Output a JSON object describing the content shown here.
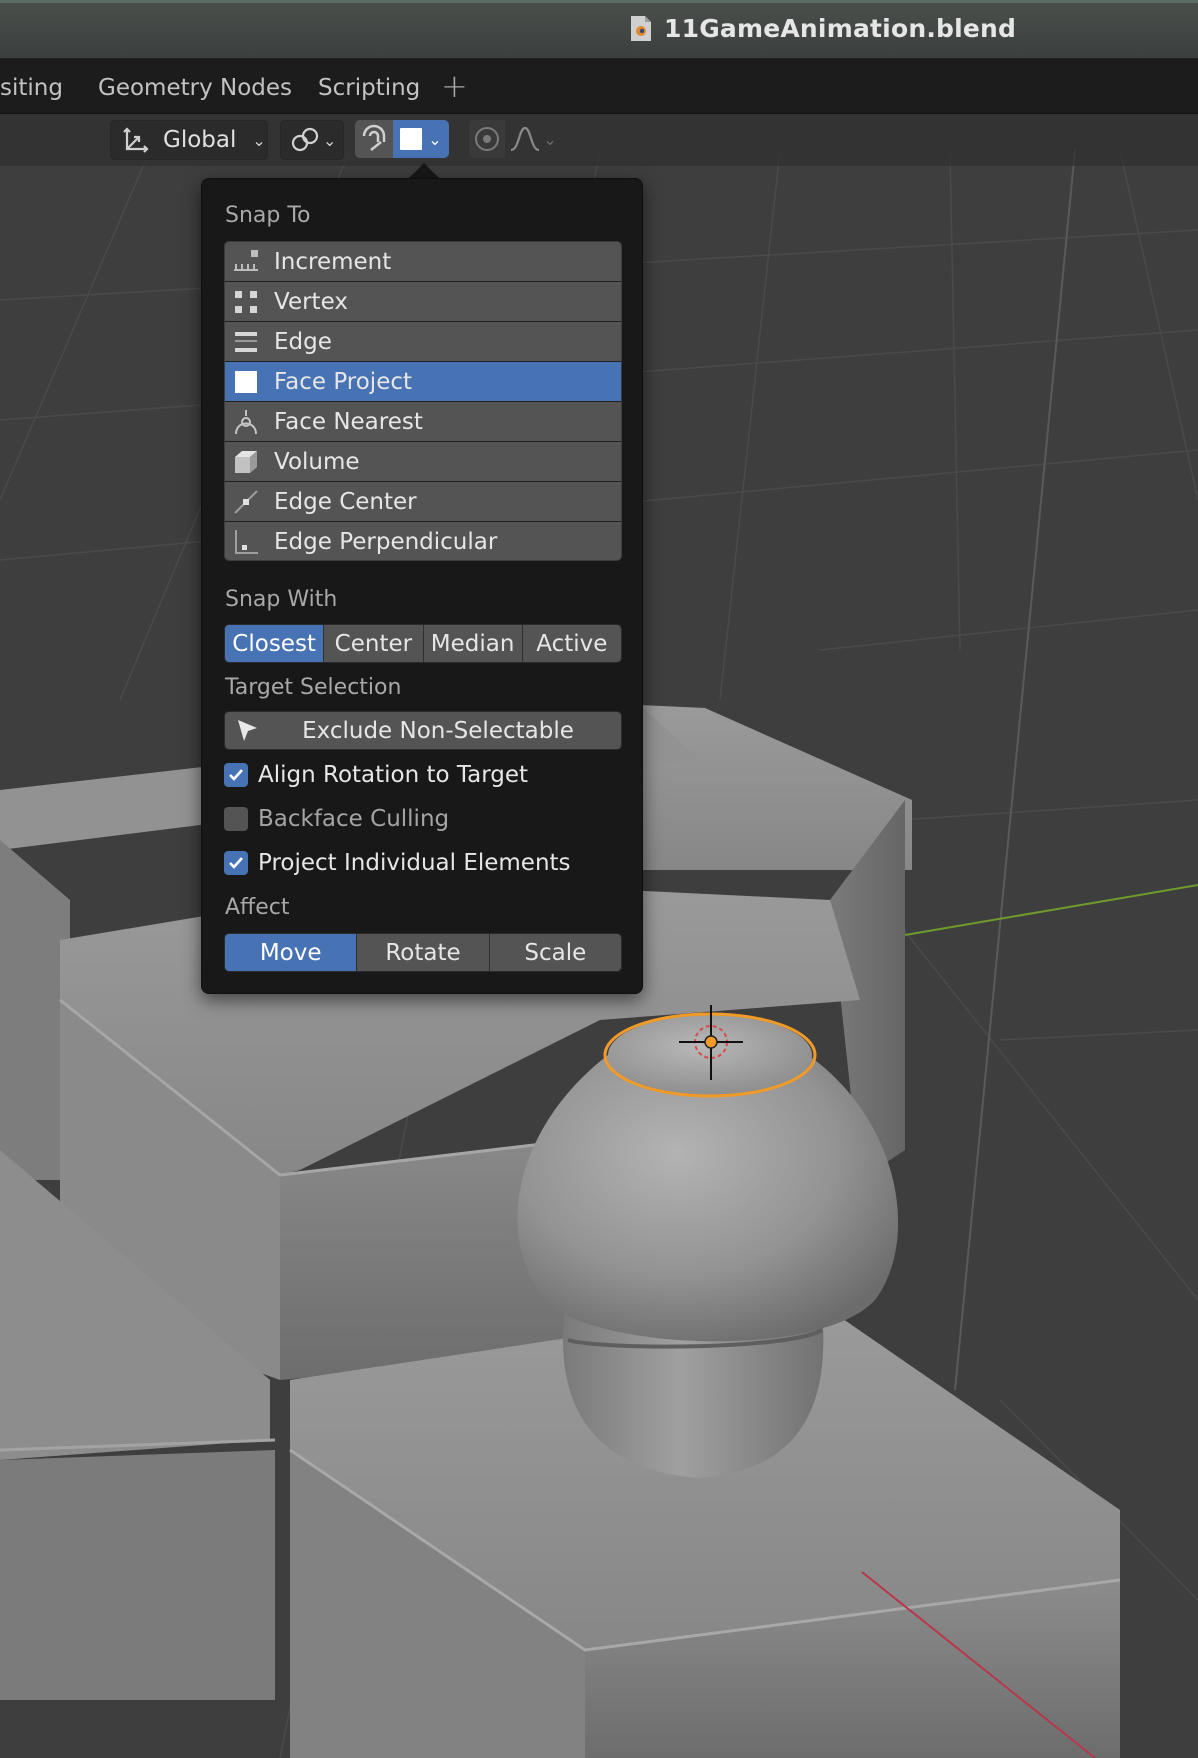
{
  "window": {
    "title": "11GameAnimation.blend",
    "file_icon": "blend-file-icon"
  },
  "workspace_tabs": [
    {
      "label": "siting"
    },
    {
      "label": "Geometry Nodes"
    },
    {
      "label": "Scripting"
    }
  ],
  "workspace_add": "+",
  "header": {
    "orientation": {
      "label": "Global",
      "icon": "transform-orientation-icon"
    },
    "pivot_icon": "pivot-point-icon",
    "snap": {
      "enabled": false,
      "current_type_icon": "face-project-icon"
    },
    "proportional": {
      "enabled": false,
      "falloff_icon": "smooth-falloff-icon"
    }
  },
  "snap_popup": {
    "snap_to_label": "Snap To",
    "snap_to_items": [
      {
        "label": "Increment",
        "icon": "increment-icon",
        "selected": false
      },
      {
        "label": "Vertex",
        "icon": "vertex-icon",
        "selected": false
      },
      {
        "label": "Edge",
        "icon": "edge-icon",
        "selected": false
      },
      {
        "label": "Face Project",
        "icon": "face-project-icon",
        "selected": true
      },
      {
        "label": "Face Nearest",
        "icon": "face-nearest-icon",
        "selected": false
      },
      {
        "label": "Volume",
        "icon": "volume-icon",
        "selected": false
      },
      {
        "label": "Edge Center",
        "icon": "edge-center-icon",
        "selected": false
      },
      {
        "label": "Edge Perpendicular",
        "icon": "edge-perpendicular-icon",
        "selected": false
      }
    ],
    "snap_with_label": "Snap With",
    "snap_with_options": [
      {
        "label": "Closest",
        "active": true
      },
      {
        "label": "Center",
        "active": false
      },
      {
        "label": "Median",
        "active": false
      },
      {
        "label": "Active",
        "active": false
      }
    ],
    "target_selection_label": "Target Selection",
    "exclude_button": "Exclude Non-Selectable",
    "checkboxes": [
      {
        "label": "Align Rotation to Target",
        "checked": true
      },
      {
        "label": "Backface Culling",
        "checked": false
      },
      {
        "label": "Project Individual Elements",
        "checked": true
      }
    ],
    "affect_label": "Affect",
    "affect_options": [
      {
        "label": "Move",
        "active": true
      },
      {
        "label": "Rotate",
        "active": false
      },
      {
        "label": "Scale",
        "active": false
      }
    ]
  },
  "colors": {
    "accent_blue": "#4772b3",
    "selection_outline": "#f09a28",
    "viewport_bg": "#3d3d3d",
    "x_axis": "#b7384b",
    "y_axis": "#6f9a2c"
  }
}
